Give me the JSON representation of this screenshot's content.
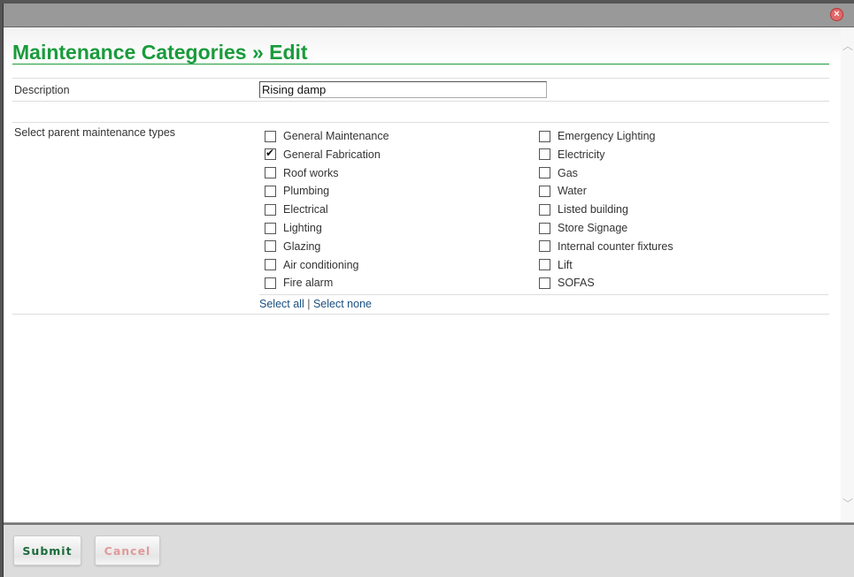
{
  "dialog": {
    "close_icon": "×",
    "title": "Maintenance Categories » Edit"
  },
  "form": {
    "description_label": "Description",
    "description_value": "Rising damp",
    "parent_types_label": "Select parent maintenance types",
    "parent_types": {
      "left": [
        {
          "label": "General Maintenance",
          "checked": false
        },
        {
          "label": "General Fabrication",
          "checked": true
        },
        {
          "label": "Roof works",
          "checked": false
        },
        {
          "label": "Plumbing",
          "checked": false
        },
        {
          "label": "Electrical",
          "checked": false
        },
        {
          "label": "Lighting",
          "checked": false
        },
        {
          "label": "Glazing",
          "checked": false
        },
        {
          "label": "Air conditioning",
          "checked": false
        },
        {
          "label": "Fire alarm",
          "checked": false
        }
      ],
      "right": [
        {
          "label": "Emergency Lighting",
          "checked": false
        },
        {
          "label": "Electricity",
          "checked": false
        },
        {
          "label": "Gas",
          "checked": false
        },
        {
          "label": "Water",
          "checked": false
        },
        {
          "label": "Listed building",
          "checked": false
        },
        {
          "label": "Store Signage",
          "checked": false
        },
        {
          "label": "Internal counter fixtures",
          "checked": false
        },
        {
          "label": "Lift",
          "checked": false
        },
        {
          "label": "SOFAS",
          "checked": false
        }
      ]
    },
    "select_all_label": "Select all",
    "separator": "|",
    "select_none_label": "Select none"
  },
  "footer": {
    "submit_label": "Submit",
    "cancel_label": "Cancel"
  },
  "scrollbar": {
    "up_icon": "︿",
    "down_icon": "﹀"
  }
}
